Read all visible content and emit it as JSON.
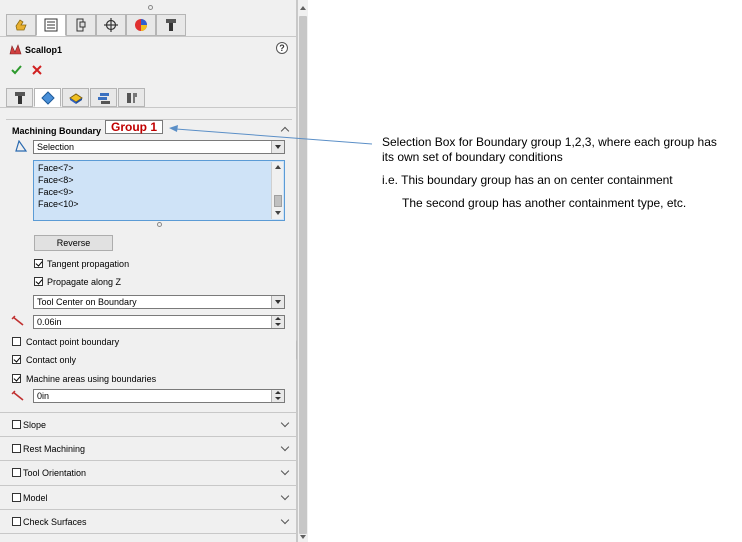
{
  "panel": {
    "title": "Scallop1",
    "help_glyph": "?",
    "tabs": [
      {
        "icon": "feature-manager-icon",
        "active": false
      },
      {
        "icon": "property-manager-icon",
        "active": true
      },
      {
        "icon": "configuration-manager-icon",
        "active": false
      },
      {
        "icon": "dimxpert-icon",
        "active": false
      },
      {
        "icon": "display-manager-icon",
        "active": false
      },
      {
        "icon": "cam-tool-icon",
        "active": false
      }
    ],
    "subtabs": [
      {
        "icon": "tool-icon",
        "active": false
      },
      {
        "icon": "boundary-icon",
        "active": true
      },
      {
        "icon": "stock-icon",
        "active": false
      },
      {
        "icon": "params-icon",
        "active": false
      },
      {
        "icon": "links-icon",
        "active": false
      }
    ],
    "machining_boundary": {
      "title": "Machining Boundary",
      "group_label": "Group 1",
      "selection_combo": "Selection",
      "faces": [
        "Face<7>",
        "Face<8>",
        "Face<9>",
        "Face<10>"
      ],
      "reverse_label": "Reverse",
      "tangent_propagation": {
        "label": "Tangent propagation",
        "checked": true
      },
      "propagate_along_z": {
        "label": "Propagate along Z",
        "checked": true
      },
      "containment_combo": "Tool Center on Boundary",
      "offset_value": "0.06in",
      "contact_point_boundary": {
        "label": "Contact point boundary",
        "checked": false
      },
      "contact_only": {
        "label": "Contact only",
        "checked": true
      },
      "machine_areas": {
        "label": "Machine areas using boundaries",
        "checked": true
      },
      "offset2_value": "0in"
    },
    "sections": [
      {
        "label": "Slope",
        "checked": false
      },
      {
        "label": "Rest Machining",
        "checked": false
      },
      {
        "label": "Tool Orientation",
        "checked": false
      },
      {
        "label": "Model",
        "checked": false
      },
      {
        "label": "Check Surfaces",
        "checked": false
      }
    ]
  },
  "annotation": {
    "line1": "Selection Box for Boundary group 1,2,3, where each group has",
    "line2": "its own set of boundary conditions",
    "line3": "i.e. This boundary group has an on center containment",
    "line4": "The second group has another containment type, etc."
  },
  "colors": {
    "group_label": "#c00000",
    "listbox_bg": "#cfe3f7",
    "accept": "#2e9a2e",
    "cancel": "#d02020",
    "arrow": "#5b8fc7"
  }
}
